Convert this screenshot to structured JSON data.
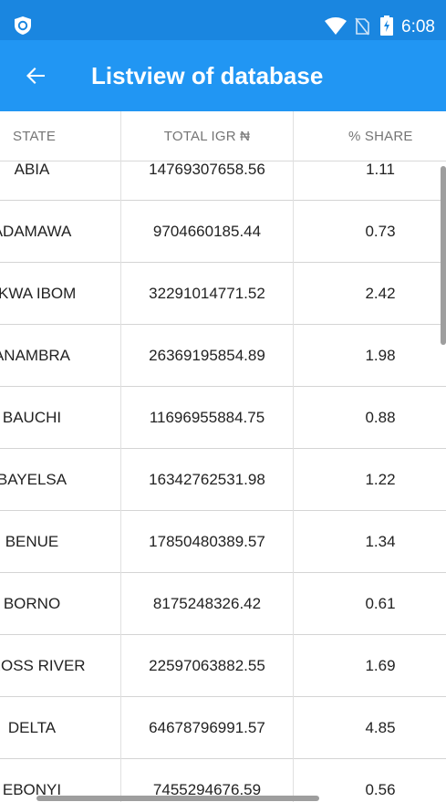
{
  "status_bar": {
    "time": "6:08",
    "icons": [
      "shield-icon",
      "wifi-icon",
      "no-sim-icon",
      "battery-charging-icon"
    ]
  },
  "app_bar": {
    "title": "Listview of database",
    "back_icon": "arrow-back-icon"
  },
  "table": {
    "columns": [
      "STATE",
      "TOTAL IGR ₦",
      "% SHARE"
    ],
    "rows": [
      {
        "state": "ABIA",
        "igr": "14769307658.56",
        "share": "1.11"
      },
      {
        "state": "ADAMAWA",
        "igr": "9704660185.44",
        "share": "0.73"
      },
      {
        "state": "AKWA IBOM",
        "igr": "32291014771.52",
        "share": "2.42"
      },
      {
        "state": "ANAMBRA",
        "igr": "26369195854.89",
        "share": "1.98"
      },
      {
        "state": "BAUCHI",
        "igr": "11696955884.75",
        "share": "0.88"
      },
      {
        "state": "BAYELSA",
        "igr": "16342762531.98",
        "share": "1.22"
      },
      {
        "state": "BENUE",
        "igr": "17850480389.57",
        "share": "1.34"
      },
      {
        "state": "BORNO",
        "igr": "8175248326.42",
        "share": "0.61"
      },
      {
        "state": "CROSS RIVER",
        "igr": "22597063882.55",
        "share": "1.69"
      },
      {
        "state": "DELTA",
        "igr": "64678796991.57",
        "share": "4.85"
      },
      {
        "state": "EBONYI",
        "igr": "7455294676.59",
        "share": "0.56"
      }
    ]
  }
}
